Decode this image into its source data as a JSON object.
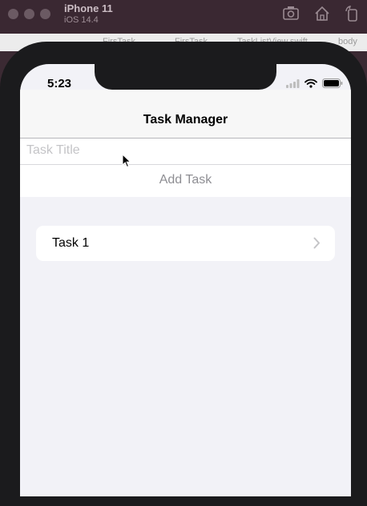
{
  "simulator": {
    "device_name": "iPhone 11",
    "os_version": "iOS 14.4",
    "toolbar_icons": [
      "screenshot-icon",
      "home-icon",
      "rotate-icon"
    ]
  },
  "xcode_breadcrumb": {
    "items": [
      "FirsTask",
      "FirsTask",
      "TaskListView.swift",
      "body"
    ]
  },
  "status_bar": {
    "time": "5:23",
    "icons": [
      "signal-icon",
      "wifi-icon",
      "battery-icon"
    ]
  },
  "nav": {
    "title": "Task Manager"
  },
  "form": {
    "title_placeholder": "Task Title",
    "title_value": "",
    "add_button_label": "Add Task"
  },
  "tasks": [
    {
      "label": "Task 1"
    }
  ],
  "colors": {
    "background": "#f2f2f7",
    "button_text": "#8e8e93",
    "placeholder": "#c4c4c7"
  }
}
